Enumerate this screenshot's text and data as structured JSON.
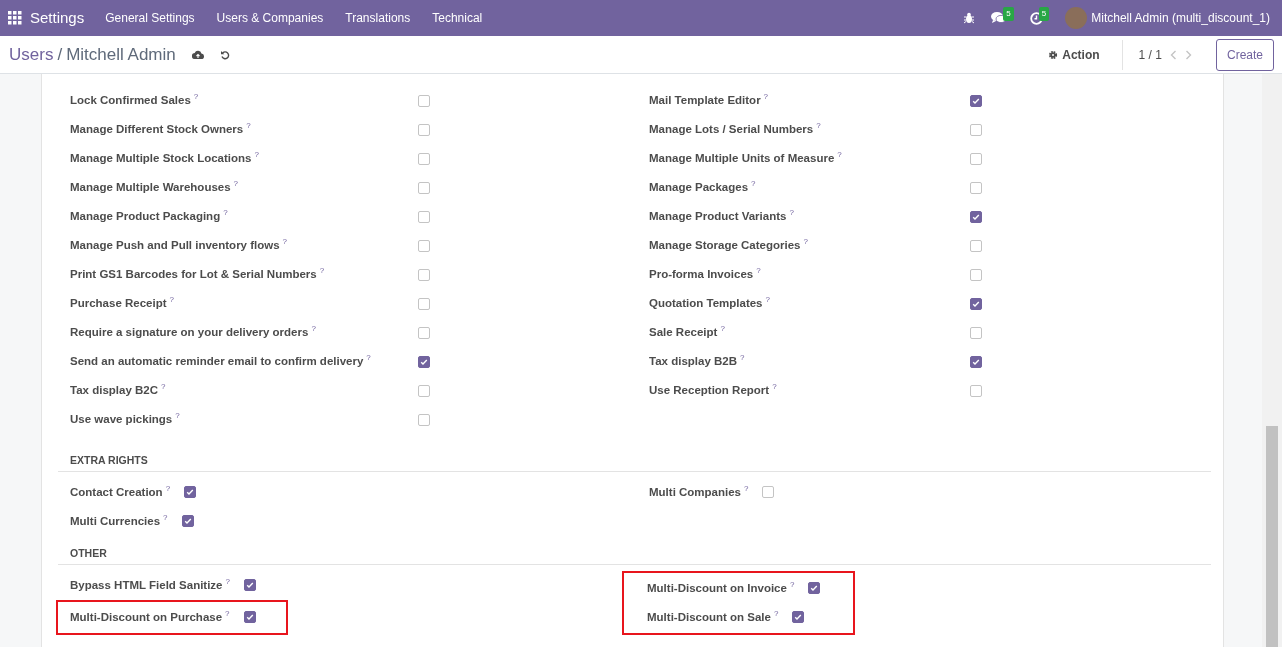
{
  "navbar": {
    "app": "Settings",
    "menu": [
      "General Settings",
      "Users & Companies",
      "Translations",
      "Technical"
    ],
    "messages_badge": "5",
    "activities_badge": "5",
    "user": "Mitchell Admin (multi_discount_1)"
  },
  "control_panel": {
    "breadcrumb": [
      "Users",
      "Mitchell Admin"
    ],
    "separator": "/",
    "action": "Action",
    "pager": "1 / 1",
    "create": "Create"
  },
  "sections": [
    {
      "kind": "wide",
      "left": [
        {
          "label": "Lock Confirmed Sales",
          "hint": "?",
          "checked": false,
          "highlighted": false
        },
        {
          "label": "Manage Different Stock Owners",
          "hint": "?",
          "checked": false,
          "highlighted": false
        },
        {
          "label": "Manage Multiple Stock Locations",
          "hint": "?",
          "checked": false,
          "highlighted": false
        },
        {
          "label": "Manage Multiple Warehouses",
          "hint": "?",
          "checked": false,
          "highlighted": false
        },
        {
          "label": "Manage Product Packaging",
          "hint": "?",
          "checked": false,
          "highlighted": false
        },
        {
          "label": "Manage Push and Pull inventory flows",
          "hint": "?",
          "checked": false,
          "highlighted": false
        },
        {
          "label": "Print GS1 Barcodes for Lot & Serial Numbers",
          "hint": "?",
          "checked": false,
          "highlighted": false
        },
        {
          "label": "Purchase Receipt",
          "hint": "?",
          "checked": false,
          "highlighted": false
        },
        {
          "label": "Require a signature on your delivery orders",
          "hint": "?",
          "checked": false,
          "highlighted": false
        },
        {
          "label": "Send an automatic reminder email to confirm delivery",
          "hint": "?",
          "checked": true,
          "highlighted": false
        },
        {
          "label": "Tax display B2C",
          "hint": "?",
          "checked": false,
          "highlighted": false
        },
        {
          "label": "Use wave pickings",
          "hint": "?",
          "checked": false,
          "highlighted": false
        }
      ],
      "right": [
        {
          "label": "Mail Template Editor",
          "hint": "?",
          "checked": true,
          "highlighted": false
        },
        {
          "label": "Manage Lots / Serial Numbers",
          "hint": "?",
          "checked": false,
          "highlighted": false
        },
        {
          "label": "Manage Multiple Units of Measure",
          "hint": "?",
          "checked": false,
          "highlighted": false
        },
        {
          "label": "Manage Packages",
          "hint": "?",
          "checked": false,
          "highlighted": false
        },
        {
          "label": "Manage Product Variants",
          "hint": "?",
          "checked": true,
          "highlighted": false
        },
        {
          "label": "Manage Storage Categories",
          "hint": "?",
          "checked": false,
          "highlighted": false
        },
        {
          "label": "Pro-forma Invoices",
          "hint": "?",
          "checked": false,
          "highlighted": false
        },
        {
          "label": "Quotation Templates",
          "hint": "?",
          "checked": true,
          "highlighted": false
        },
        {
          "label": "Sale Receipt",
          "hint": "?",
          "checked": false,
          "highlighted": false
        },
        {
          "label": "Tax display B2B",
          "hint": "?",
          "checked": true,
          "highlighted": false
        },
        {
          "label": "Use Reception Report",
          "hint": "?",
          "checked": false,
          "highlighted": false
        }
      ]
    },
    {
      "kind": "compact",
      "title": "EXTRA RIGHTS",
      "left": [
        {
          "label": "Contact Creation",
          "hint": "?",
          "checked": true,
          "highlighted": false
        },
        {
          "label": "Multi Currencies",
          "hint": "?",
          "checked": true,
          "highlighted": false
        }
      ],
      "right": [
        {
          "label": "Multi Companies",
          "hint": "?",
          "checked": false,
          "highlighted": false
        }
      ]
    },
    {
      "kind": "compact",
      "title": "OTHER",
      "left": [
        {
          "label": "Bypass HTML Field Sanitize",
          "hint": "?",
          "checked": true,
          "highlighted": false
        },
        {
          "label": "Multi-Discount on Purchase",
          "hint": "?",
          "checked": true,
          "highlighted": true
        }
      ],
      "right": [
        {
          "label": "Multi-Discount on Invoice",
          "hint": "?",
          "checked": true,
          "highlighted": true
        },
        {
          "label": "Multi-Discount on Sale",
          "hint": "?",
          "checked": true,
          "highlighted": true
        }
      ]
    }
  ]
}
